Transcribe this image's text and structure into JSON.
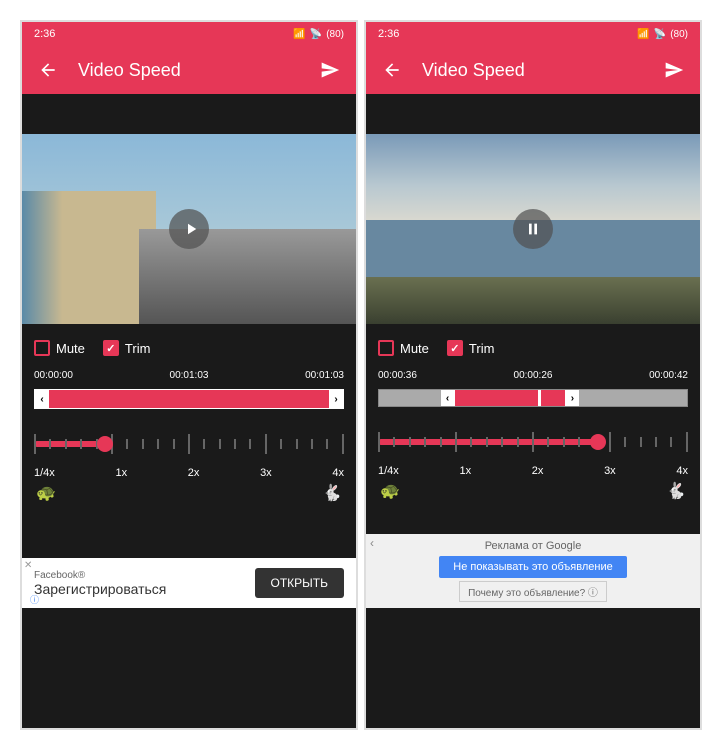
{
  "status": {
    "time": "2:36",
    "signal": "📶",
    "battery": "80"
  },
  "header": {
    "title": "Video Speed"
  },
  "controls": {
    "mute_label": "Mute",
    "trim_label": "Trim",
    "mute_checked": false,
    "trim_checked": true
  },
  "left": {
    "times": {
      "start": "00:00:00",
      "mid": "00:01:03",
      "end": "00:01:03"
    },
    "speed_position_pct": 23,
    "ad": {
      "brand": "Facebook®",
      "title": "Зарегистрироваться",
      "button": "ОТКРЫТЬ"
    }
  },
  "right": {
    "times": {
      "start": "00:00:36",
      "mid": "00:00:26",
      "end": "00:00:42"
    },
    "speed_position_pct": 71,
    "ad": {
      "label": "Реклама от Google",
      "hide": "Не показывать это объявление",
      "why": "Почему это объявление? ⓘ"
    }
  },
  "speed": {
    "labels": [
      "1/4x",
      "1x",
      "2x",
      "3x",
      "4x"
    ]
  }
}
